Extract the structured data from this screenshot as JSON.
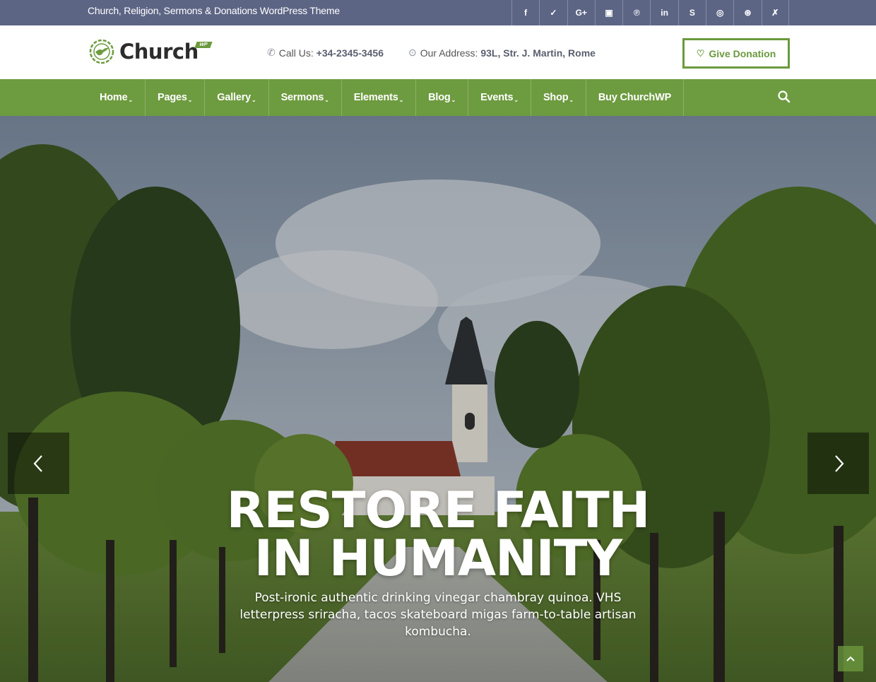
{
  "topbar": {
    "tagline": "Church, Religion, Sermons & Donations WordPress Theme",
    "socials": [
      {
        "icon": "facebook-icon",
        "glyph": "f"
      },
      {
        "icon": "twitter-icon",
        "glyph": "✓"
      },
      {
        "icon": "google-plus-icon",
        "glyph": "G+"
      },
      {
        "icon": "youtube-icon",
        "glyph": "▣"
      },
      {
        "icon": "pinterest-icon",
        "glyph": "℗"
      },
      {
        "icon": "linkedin-icon",
        "glyph": "in"
      },
      {
        "icon": "skype-icon",
        "glyph": "S"
      },
      {
        "icon": "instagram-icon",
        "glyph": "◎"
      },
      {
        "icon": "dribbble-icon",
        "glyph": "⊛"
      },
      {
        "icon": "joomla-icon",
        "glyph": "✗"
      }
    ]
  },
  "header": {
    "logo_text": "Church",
    "logo_badge": "WP",
    "phone_label": "Call Us:",
    "phone_value": "+34-2345-3456",
    "address_label": "Our Address:",
    "address_value": "93L, Str. J. Martin, Rome",
    "donate_label": "Give Donation"
  },
  "nav": {
    "items": [
      {
        "label": "Home",
        "dropdown": true
      },
      {
        "label": "Pages",
        "dropdown": true
      },
      {
        "label": "Gallery",
        "dropdown": true
      },
      {
        "label": "Sermons",
        "dropdown": true
      },
      {
        "label": "Elements",
        "dropdown": true
      },
      {
        "label": "Blog",
        "dropdown": true
      },
      {
        "label": "Events",
        "dropdown": true
      },
      {
        "label": "Shop",
        "dropdown": true
      },
      {
        "label": "Buy ChurchWP",
        "dropdown": false
      }
    ]
  },
  "hero": {
    "headline_line1": "RESTORE FAITH",
    "headline_line2": "IN HUMANITY",
    "subtext": "Post-ironic authentic drinking vinegar chambray quinoa. VHS letterpress sriracha, tacos skateboard migas farm-to-table artisan kombucha."
  },
  "colors": {
    "accent_green": "#6d9b3f",
    "topbar_bg": "#5d6585"
  }
}
